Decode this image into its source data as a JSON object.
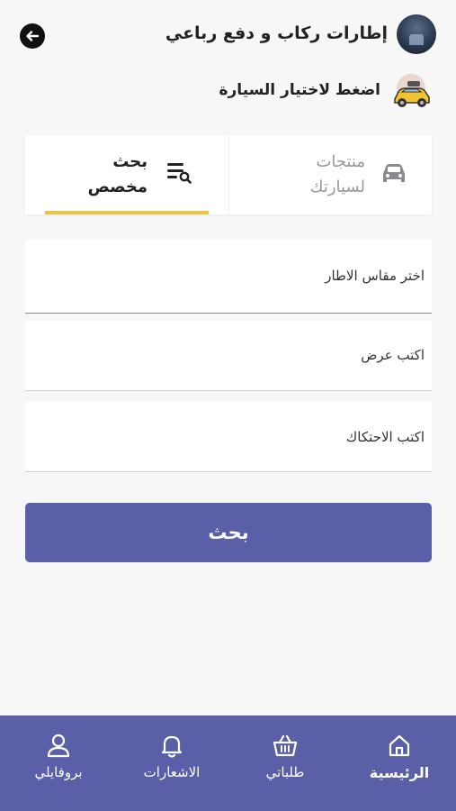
{
  "header": {
    "title": "إطارات ركاب و دفع رباعي",
    "select_car_prompt": "اضغط لاختيار السيارة"
  },
  "tabs": [
    {
      "label": "منتجات\nلسيارتك",
      "line1": "منتجات",
      "line2": "لسيارتك",
      "icon": "car-icon",
      "active": false
    },
    {
      "label": "بحث\nمخصص",
      "line1": "بحث",
      "line2": "مخصص",
      "icon": "search-list-icon",
      "active": true
    }
  ],
  "form": {
    "tire_size": "اختر مقاس الاطار",
    "width": "اكتب عرض",
    "friction": "اكتب الاحتكاك",
    "search_button": "بحث"
  },
  "bottom_nav": {
    "home": "الرئيسية",
    "orders": "طلباتي",
    "notifications": "الاشعارات",
    "profile": "بروفايلي"
  },
  "colors": {
    "primary": "#5a5fa8",
    "accent_underline": "#e7c445",
    "background": "#f7f7f8"
  }
}
